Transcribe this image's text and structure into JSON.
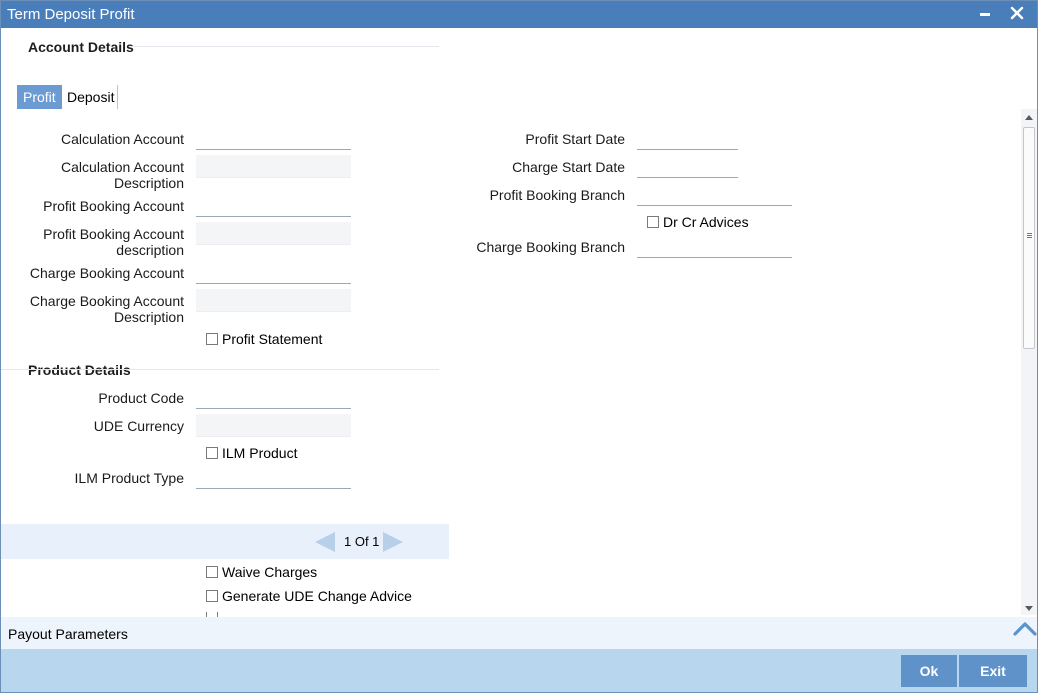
{
  "window": {
    "title": "Term Deposit Profit"
  },
  "account_details": {
    "heading": "Account Details",
    "tabs": [
      {
        "label": "Profit"
      },
      {
        "label": "Deposit"
      }
    ],
    "left_fields": {
      "calc_account": "Calculation Account",
      "calc_account_desc_1": "Calculation Account",
      "calc_account_desc_2": "Description",
      "profit_booking_account": "Profit Booking Account",
      "profit_booking_desc_1": "Profit Booking Account",
      "profit_booking_desc_2": "description",
      "charge_booking_account": "Charge Booking Account",
      "charge_booking_desc_1": "Charge Booking Account",
      "charge_booking_desc_2": "Description",
      "profit_statement": "Profit Statement"
    },
    "right_fields": {
      "profit_start_date": "Profit Start Date",
      "charge_start_date": "Charge Start Date",
      "profit_booking_branch": "Profit Booking Branch",
      "dr_cr_advices": "Dr Cr Advices",
      "charge_booking_branch": "Charge Booking Branch"
    }
  },
  "product_details": {
    "heading": "Product Details",
    "product_code": "Product Code",
    "ude_currency": "UDE Currency",
    "ilm_product": "ILM Product",
    "ilm_product_type": "ILM Product Type"
  },
  "pager": {
    "text": "1 Of 1"
  },
  "options": {
    "waive_charges": "Waive Charges",
    "generate_ude_change_advice": "Generate UDE Change Advice"
  },
  "payout": {
    "label": "Payout Parameters"
  },
  "footer": {
    "ok_label": "Ok",
    "exit_label": "Exit"
  }
}
